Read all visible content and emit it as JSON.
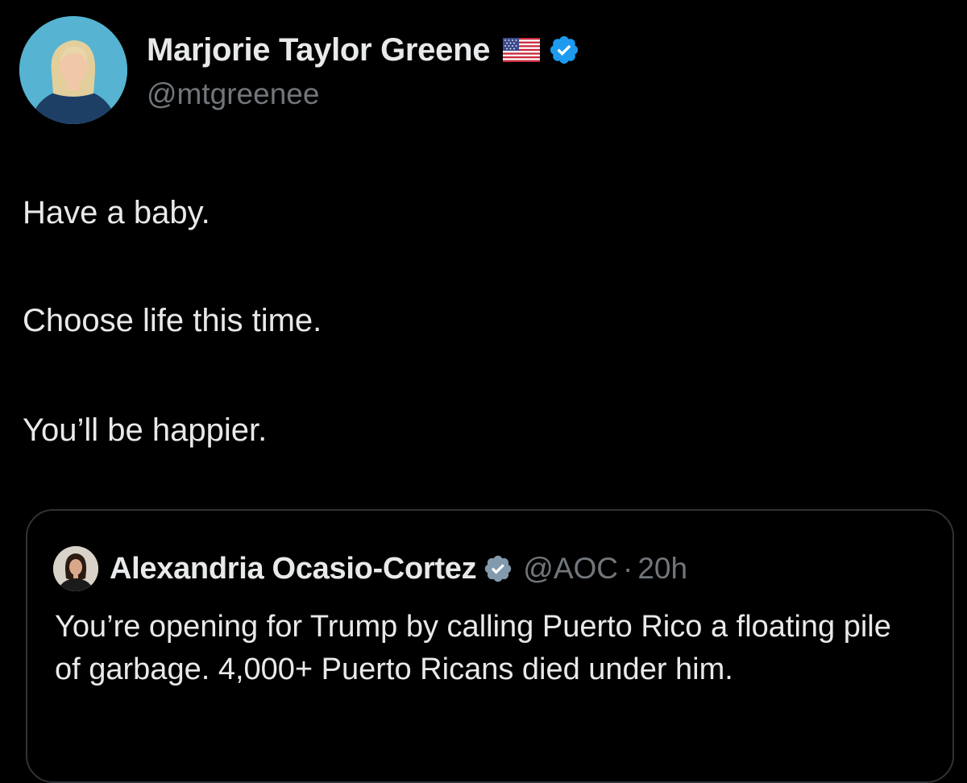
{
  "tweet": {
    "author": {
      "display_name": "Marjorie Taylor Greene",
      "handle": "@mtgreenee",
      "flag_icon": "us-flag-icon",
      "verified_icon": "verified-badge-icon",
      "verified_color": "#1d9bf0"
    },
    "body_lines": [
      "Have a baby.",
      "Choose life this time.",
      "You’ll be happier."
    ],
    "quote": {
      "author": {
        "display_name": "Alexandria Ocasio-Cortez",
        "handle": "@AOC",
        "separator": "·",
        "time": "20h",
        "verified_icon": "verified-badge-icon",
        "verified_color": "#829aab"
      },
      "text": "You’re opening for Trump by calling Puerto Rico a floating pile of garbage. 4,000+ Puerto Ricans died under him."
    }
  },
  "colors": {
    "background": "#000000",
    "text_primary": "#e7e9ea",
    "text_secondary": "#71767b",
    "border": "#2f3336"
  }
}
